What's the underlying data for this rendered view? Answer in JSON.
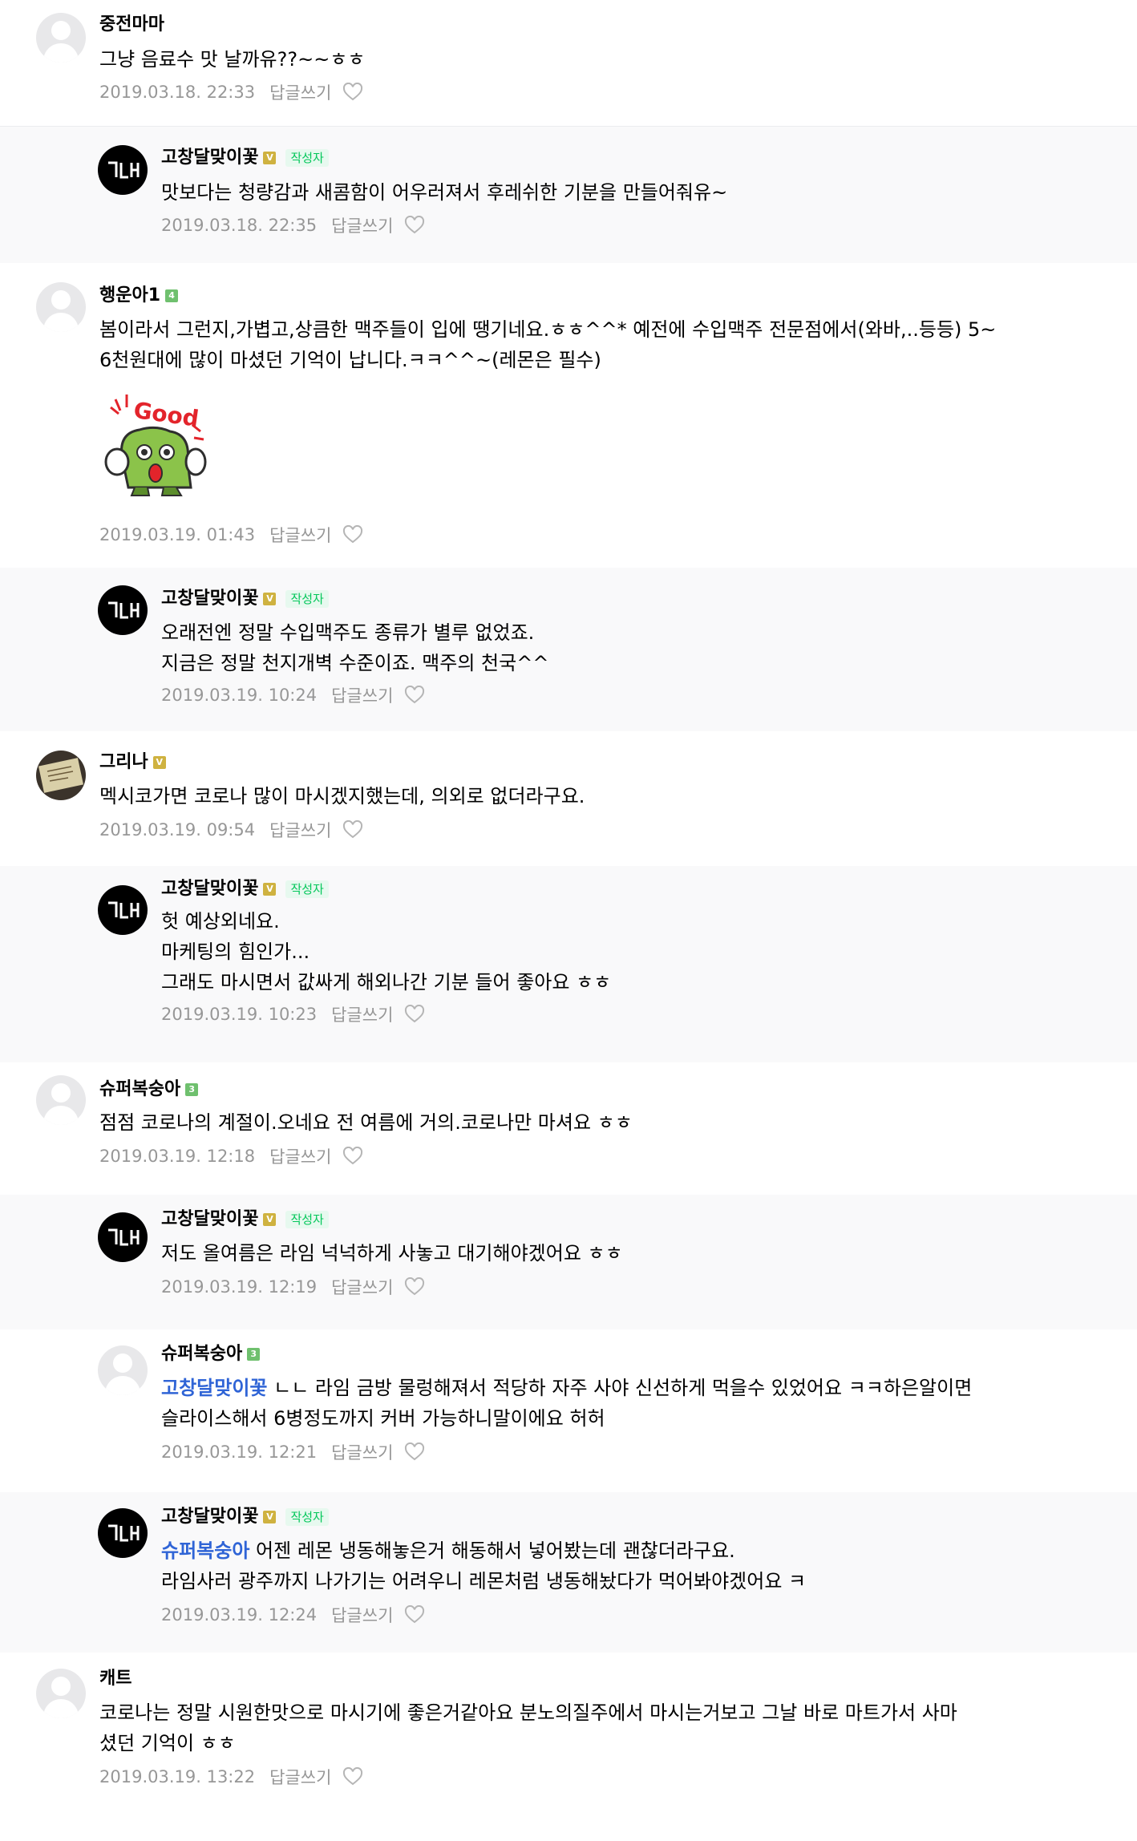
{
  "author_tag": "작성자",
  "reply_label": "답글쓰기",
  "colors": {
    "mention": "#2f64d6",
    "author_tag": "#03c75a",
    "reply_bg": "#f9f9fa",
    "meta": "#979797"
  },
  "comments": [
    {
      "nick": "중전마마",
      "lines": [
        "그냥 음료수 맛 날까유??~~ㅎㅎ"
      ],
      "date": "2019.03.18. 22:33"
    },
    {
      "nick": "고창달맞이꽃",
      "lines": [
        "맛보다는 청량감과 새콤함이 어우러져서 후레쉬한 기분을 만들어줘유~"
      ],
      "date": "2019.03.18. 22:35"
    },
    {
      "nick": "행운아1",
      "grade": "4",
      "lines": [
        "봄이라서 그런지,가볍고,상큼한 맥주들이 입에 땡기네요.ㅎㅎ^^* 예전에 수입맥주 전문점에서(와바,..등등) 5~",
        "6천원대에 많이 마셨던 기억이 납니다.ㅋㅋ^^~(레몬은 필수)"
      ],
      "sticker_text": "Good",
      "date": "2019.03.19. 01:43"
    },
    {
      "nick": "고창달맞이꽃",
      "lines": [
        "오래전엔 정말 수입맥주도 종류가 별루 없었죠.",
        "지금은 정말 천지개벽 수준이죠. 맥주의 천국^^"
      ],
      "date": "2019.03.19. 10:24"
    },
    {
      "nick": "그리나",
      "grade": "V",
      "lines": [
        "멕시코가면 코로나 많이 마시겠지했는데, 의외로 없더라구요."
      ],
      "date": "2019.03.19. 09:54"
    },
    {
      "nick": "고창달맞이꽃",
      "lines": [
        "헛 예상외네요.",
        "마케팅의 힘인가...",
        "그래도 마시면서 값싸게 해외나간 기분 들어 좋아요 ㅎㅎ"
      ],
      "date": "2019.03.19. 10:23"
    },
    {
      "nick": "슈퍼복숭아",
      "grade": "3",
      "lines": [
        "점점 코로나의 계절이.오네요 전 여름에 거의.코로나만 마셔요 ㅎㅎ"
      ],
      "date": "2019.03.19. 12:18"
    },
    {
      "nick": "고창달맞이꽃",
      "lines": [
        "저도 올여름은 라임 넉넉하게 사놓고 대기해야겠어요 ㅎㅎ"
      ],
      "date": "2019.03.19. 12:19"
    },
    {
      "nick": "슈퍼복숭아",
      "grade": "3",
      "mention": "고창달맞이꽃",
      "lines": [
        " ㄴㄴ 라임 금방 물렁해져서 적당하 자주 사야 신선하게 먹을수 있었어요 ㅋㅋ하은알이면",
        "슬라이스해서 6병정도까지 커버 가능하니말이에요 허허"
      ],
      "date": "2019.03.19. 12:21"
    },
    {
      "nick": "고창달맞이꽃",
      "mention": "슈퍼복숭아",
      "lines": [
        " 어젠 레몬 냉동해놓은거 해동해서 넣어봤는데 괜찮더라구요.",
        "라임사러 광주까지 나가기는 어려우니 레몬처럼 냉동해놨다가 먹어봐야겠어요 ㅋ"
      ],
      "date": "2019.03.19. 12:24"
    },
    {
      "nick": "캐트",
      "lines": [
        "코로나는 정말 시원한맛으로 마시기에 좋은거같아요 분노의질주에서 마시는거보고 그날 바로 마트가서 사마",
        "셨던 기억이 ㅎㅎ"
      ],
      "date": "2019.03.19. 13:22"
    }
  ]
}
